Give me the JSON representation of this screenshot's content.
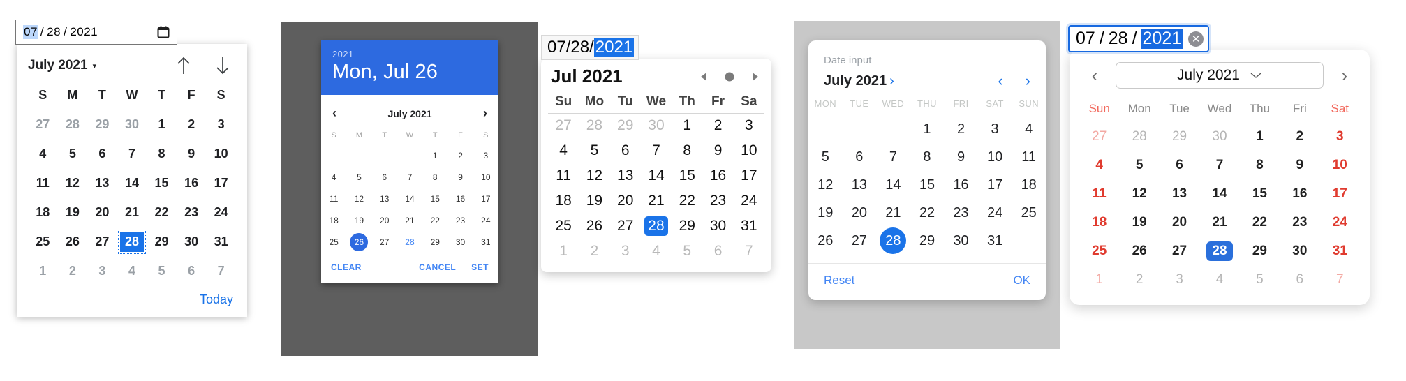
{
  "weekday_sets": {
    "single_sun": [
      "S",
      "M",
      "T",
      "W",
      "T",
      "F",
      "S"
    ],
    "two_sun": [
      "Su",
      "Mo",
      "Tu",
      "We",
      "Th",
      "Fr",
      "Sa"
    ],
    "three_mon_caps": [
      "MON",
      "TUE",
      "WED",
      "THU",
      "FRI",
      "SAT",
      "SUN"
    ],
    "three_sun": [
      "Sun",
      "Mon",
      "Tue",
      "Wed",
      "Thu",
      "Fri",
      "Sat"
    ]
  },
  "chrome_picker": {
    "input": {
      "month": "07",
      "day": "28",
      "year": "2021",
      "separator": "/",
      "selected_segment": "month"
    },
    "calendar_icon": "calendar-icon",
    "month_label": "July 2021",
    "dropdown_caret": "▾",
    "prev_icon": "arrow-up-icon",
    "next_icon": "arrow-down-icon",
    "weekdays": [
      "S",
      "M",
      "T",
      "W",
      "T",
      "F",
      "S"
    ],
    "weeks": [
      [
        {
          "d": "27",
          "m": true
        },
        {
          "d": "28",
          "m": true
        },
        {
          "d": "29",
          "m": true
        },
        {
          "d": "30",
          "m": true
        },
        {
          "d": "1"
        },
        {
          "d": "2"
        },
        {
          "d": "3"
        }
      ],
      [
        {
          "d": "4"
        },
        {
          "d": "5"
        },
        {
          "d": "6"
        },
        {
          "d": "7"
        },
        {
          "d": "8"
        },
        {
          "d": "9"
        },
        {
          "d": "10"
        }
      ],
      [
        {
          "d": "11"
        },
        {
          "d": "12"
        },
        {
          "d": "13"
        },
        {
          "d": "14"
        },
        {
          "d": "15"
        },
        {
          "d": "16"
        },
        {
          "d": "17"
        }
      ],
      [
        {
          "d": "18"
        },
        {
          "d": "19"
        },
        {
          "d": "20"
        },
        {
          "d": "21"
        },
        {
          "d": "22"
        },
        {
          "d": "23"
        },
        {
          "d": "24"
        }
      ],
      [
        {
          "d": "25"
        },
        {
          "d": "26"
        },
        {
          "d": "27"
        },
        {
          "d": "28",
          "s": true
        },
        {
          "d": "29"
        },
        {
          "d": "30"
        },
        {
          "d": "31"
        }
      ],
      [
        {
          "d": "1",
          "m": true
        },
        {
          "d": "2",
          "m": true
        },
        {
          "d": "3",
          "m": true
        },
        {
          "d": "4",
          "m": true
        },
        {
          "d": "5",
          "m": true
        },
        {
          "d": "6",
          "m": true
        },
        {
          "d": "7",
          "m": true
        }
      ]
    ],
    "today_label": "Today",
    "accent": "#1a73e8"
  },
  "material_mobile": {
    "header_year": "2021",
    "header_date": "Mon, Jul 26",
    "prev_icon": "chevron-left-icon",
    "next_icon": "chevron-right-icon",
    "month_label": "July 2021",
    "weekdays": [
      "S",
      "M",
      "T",
      "W",
      "T",
      "F",
      "S"
    ],
    "weeks": [
      [
        {
          "d": ""
        },
        {
          "d": ""
        },
        {
          "d": ""
        },
        {
          "d": ""
        },
        {
          "d": "1"
        },
        {
          "d": "2"
        },
        {
          "d": "3"
        }
      ],
      [
        {
          "d": "4"
        },
        {
          "d": "5"
        },
        {
          "d": "6"
        },
        {
          "d": "7"
        },
        {
          "d": "8"
        },
        {
          "d": "9"
        },
        {
          "d": "10"
        }
      ],
      [
        {
          "d": "11"
        },
        {
          "d": "12"
        },
        {
          "d": "13"
        },
        {
          "d": "14"
        },
        {
          "d": "15"
        },
        {
          "d": "16"
        },
        {
          "d": "17"
        }
      ],
      [
        {
          "d": "18"
        },
        {
          "d": "19"
        },
        {
          "d": "20"
        },
        {
          "d": "21"
        },
        {
          "d": "22"
        },
        {
          "d": "23"
        },
        {
          "d": "24"
        }
      ],
      [
        {
          "d": "25"
        },
        {
          "d": "26",
          "s": true
        },
        {
          "d": "27"
        },
        {
          "d": "28",
          "t": true
        },
        {
          "d": "29"
        },
        {
          "d": "30"
        },
        {
          "d": "31"
        }
      ]
    ],
    "clear_label": "CLEAR",
    "cancel_label": "CANCEL",
    "set_label": "SET",
    "accent": "#2d6ae0",
    "scrim": "#5e5e5e"
  },
  "webkit_picker": {
    "input": {
      "month": "07",
      "day": "28",
      "year": "2021",
      "separator": "/",
      "selected_segment": "year"
    },
    "month_label": "Jul 2021",
    "prev_icon": "triangle-left-icon",
    "today_icon": "circle-icon",
    "next_icon": "triangle-right-icon",
    "weekdays": [
      "Su",
      "Mo",
      "Tu",
      "We",
      "Th",
      "Fr",
      "Sa"
    ],
    "weeks": [
      [
        {
          "d": "27",
          "m": true
        },
        {
          "d": "28",
          "m": true
        },
        {
          "d": "29",
          "m": true
        },
        {
          "d": "30",
          "m": true
        },
        {
          "d": "1"
        },
        {
          "d": "2"
        },
        {
          "d": "3"
        }
      ],
      [
        {
          "d": "4"
        },
        {
          "d": "5"
        },
        {
          "d": "6"
        },
        {
          "d": "7"
        },
        {
          "d": "8"
        },
        {
          "d": "9"
        },
        {
          "d": "10"
        }
      ],
      [
        {
          "d": "11"
        },
        {
          "d": "12"
        },
        {
          "d": "13"
        },
        {
          "d": "14"
        },
        {
          "d": "15"
        },
        {
          "d": "16"
        },
        {
          "d": "17"
        }
      ],
      [
        {
          "d": "18"
        },
        {
          "d": "19"
        },
        {
          "d": "20"
        },
        {
          "d": "21"
        },
        {
          "d": "22"
        },
        {
          "d": "23"
        },
        {
          "d": "24"
        }
      ],
      [
        {
          "d": "25"
        },
        {
          "d": "26"
        },
        {
          "d": "27"
        },
        {
          "d": "28",
          "s": true
        },
        {
          "d": "29"
        },
        {
          "d": "30"
        },
        {
          "d": "31"
        }
      ],
      [
        {
          "d": "1",
          "m": true
        },
        {
          "d": "2",
          "m": true
        },
        {
          "d": "3",
          "m": true
        },
        {
          "d": "4",
          "m": true
        },
        {
          "d": "5",
          "m": true
        },
        {
          "d": "6",
          "m": true
        },
        {
          "d": "7",
          "m": true
        }
      ]
    ],
    "accent": "#1a73e8"
  },
  "material_desktop": {
    "field_label": "Date input",
    "month_label": "July 2021",
    "month_chevron": "›",
    "prev_icon": "chevron-left-icon",
    "next_icon": "chevron-right-icon",
    "weekdays": [
      "MON",
      "TUE",
      "WED",
      "THU",
      "FRI",
      "SAT",
      "SUN"
    ],
    "weeks": [
      [
        {
          "d": ""
        },
        {
          "d": ""
        },
        {
          "d": ""
        },
        {
          "d": "1"
        },
        {
          "d": "2"
        },
        {
          "d": "3"
        },
        {
          "d": "4"
        }
      ],
      [
        {
          "d": "5"
        },
        {
          "d": "6"
        },
        {
          "d": "7"
        },
        {
          "d": "8"
        },
        {
          "d": "9"
        },
        {
          "d": "10"
        },
        {
          "d": "11"
        }
      ],
      [
        {
          "d": "12"
        },
        {
          "d": "13"
        },
        {
          "d": "14"
        },
        {
          "d": "15"
        },
        {
          "d": "16"
        },
        {
          "d": "17"
        },
        {
          "d": "18"
        }
      ],
      [
        {
          "d": "19"
        },
        {
          "d": "20"
        },
        {
          "d": "21"
        },
        {
          "d": "22"
        },
        {
          "d": "23"
        },
        {
          "d": "24"
        },
        {
          "d": "25"
        }
      ],
      [
        {
          "d": "26"
        },
        {
          "d": "27"
        },
        {
          "d": "28",
          "s": true
        },
        {
          "d": "29"
        },
        {
          "d": "30"
        },
        {
          "d": "31"
        },
        {
          "d": ""
        }
      ]
    ],
    "reset_label": "Reset",
    "ok_label": "OK",
    "accent": "#1a73e8",
    "scrim": "#c8c8c8"
  },
  "macos_picker": {
    "input": {
      "month": "07",
      "day": "28",
      "year": "2021",
      "separator": "/",
      "selected_segment": "year"
    },
    "clear_icon": "clear-circle-icon",
    "prev_icon": "chevron-left-icon",
    "next_icon": "chevron-right-icon",
    "month_label": "July 2021",
    "month_chevron": "⌄",
    "weekdays": [
      "Sun",
      "Mon",
      "Tue",
      "Wed",
      "Thu",
      "Fri",
      "Sat"
    ],
    "weeks": [
      [
        {
          "d": "27",
          "m": true,
          "w": true
        },
        {
          "d": "28",
          "m": true
        },
        {
          "d": "29",
          "m": true
        },
        {
          "d": "30",
          "m": true
        },
        {
          "d": "1"
        },
        {
          "d": "2"
        },
        {
          "d": "3",
          "w": true
        }
      ],
      [
        {
          "d": "4",
          "w": true
        },
        {
          "d": "5"
        },
        {
          "d": "6"
        },
        {
          "d": "7"
        },
        {
          "d": "8"
        },
        {
          "d": "9"
        },
        {
          "d": "10",
          "w": true
        }
      ],
      [
        {
          "d": "11",
          "w": true
        },
        {
          "d": "12"
        },
        {
          "d": "13"
        },
        {
          "d": "14"
        },
        {
          "d": "15"
        },
        {
          "d": "16"
        },
        {
          "d": "17",
          "w": true
        }
      ],
      [
        {
          "d": "18",
          "w": true
        },
        {
          "d": "19"
        },
        {
          "d": "20"
        },
        {
          "d": "21"
        },
        {
          "d": "22"
        },
        {
          "d": "23"
        },
        {
          "d": "24",
          "w": true
        }
      ],
      [
        {
          "d": "25",
          "w": true
        },
        {
          "d": "26"
        },
        {
          "d": "27"
        },
        {
          "d": "28",
          "s": true
        },
        {
          "d": "29"
        },
        {
          "d": "30"
        },
        {
          "d": "31",
          "w": true
        }
      ],
      [
        {
          "d": "1",
          "m": true,
          "w": true
        },
        {
          "d": "2",
          "m": true
        },
        {
          "d": "3",
          "m": true
        },
        {
          "d": "4",
          "m": true
        },
        {
          "d": "5",
          "m": true
        },
        {
          "d": "6",
          "m": true
        },
        {
          "d": "7",
          "m": true,
          "w": true
        }
      ]
    ],
    "accent": "#2a6fdb",
    "weekend_color": "#e03b2f"
  }
}
